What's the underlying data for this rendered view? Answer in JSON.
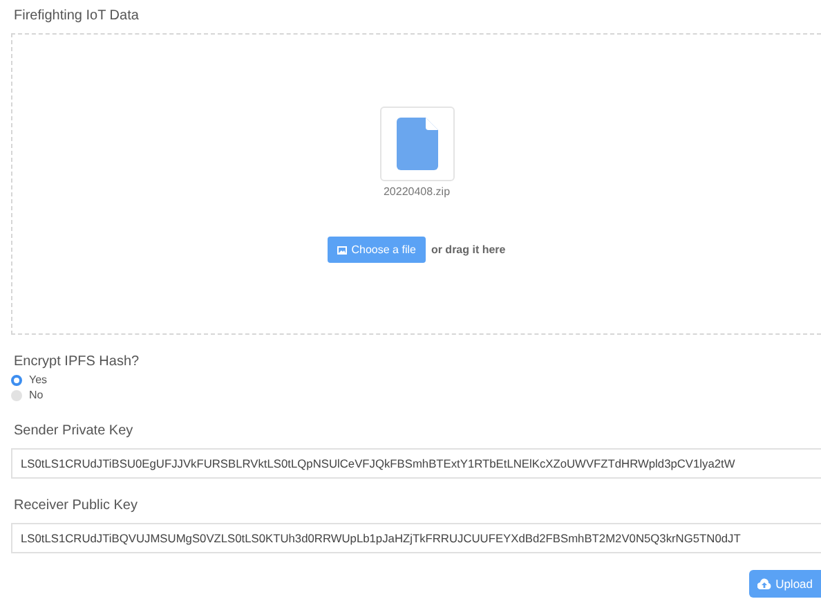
{
  "dropzone": {
    "label": "Firefighting IoT Data",
    "file_name": "20220408.zip",
    "choose_button": "Choose a file",
    "drag_hint": "or drag it here"
  },
  "encrypt": {
    "label": "Encrypt IPFS Hash?",
    "options": [
      {
        "label": "Yes",
        "selected": true
      },
      {
        "label": "No",
        "selected": false
      }
    ]
  },
  "fields": [
    {
      "label": "Sender Private Key",
      "value": "LS0tLS1CRUdJTiBSU0EgUFJJVkFURSBLRVktLS0tLQpNSUlCeVFJQkFBSmhBTExtY1RTbEtLNElKcXZoUWVFZTdHRWpld3pCV1lya2tW"
    },
    {
      "label": "Receiver Public Key",
      "value": "LS0tLS1CRUdJTiBQVUJMSUMgS0VZLS0tLS0KTUh3d0RRWUpLb1pJaHZjTkFRRUJCUUFEYXdBd2FBSmhBT2M2V0N5Q3krNG5TN0dJT"
    }
  ],
  "upload_button": "Upload"
}
